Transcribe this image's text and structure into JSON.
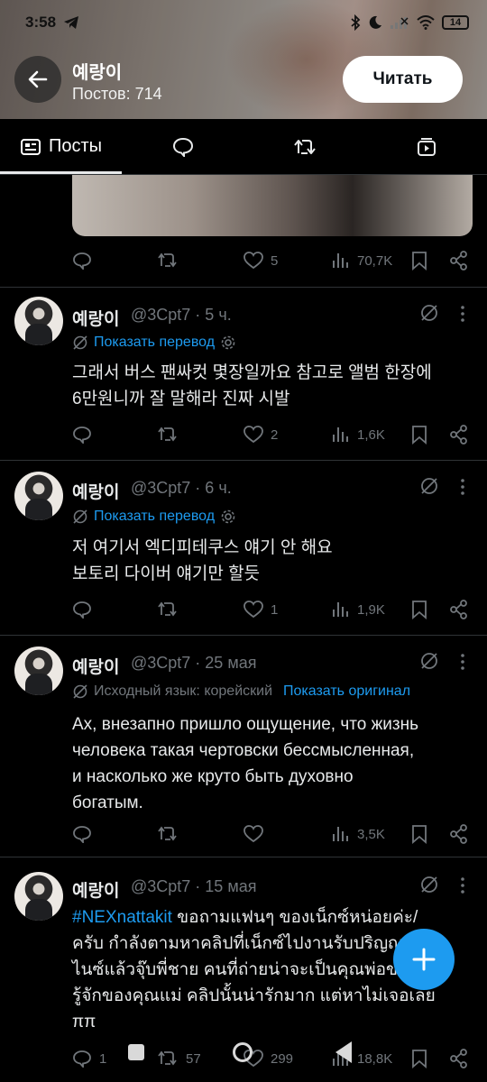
{
  "status_bar": {
    "time": "3:58",
    "battery": "14"
  },
  "profile": {
    "name": "예랑이",
    "posts_count": "Постов: 714",
    "follow_label": "Читать"
  },
  "tabs": [
    {
      "icon": "posts-icon",
      "label": "Посты",
      "active": true
    },
    {
      "icon": "replies-icon",
      "label": ""
    },
    {
      "icon": "retweet-icon",
      "label": ""
    },
    {
      "icon": "media-icon",
      "label": ""
    }
  ],
  "top_post_actions": {
    "replies": "",
    "reposts": "",
    "likes": "5",
    "views": "70,7K"
  },
  "tweets": [
    {
      "name": "예랑이",
      "handle_time": "@3Cpt7 · 5 ч.",
      "translation_link": "Показать перевод",
      "text_lines": [
        "그래서 버스 팬싸컷 몇장일까요 참고로 앨범 한장에",
        "6만원니까 잘 말해라 진짜 시발"
      ],
      "actions": {
        "replies": "",
        "reposts": "",
        "likes": "2",
        "views": "1,6K"
      }
    },
    {
      "name": "예랑이",
      "handle_time": "@3Cpt7 · 6 ч.",
      "translation_link": "Показать перевод",
      "text_lines": [
        "저 여기서 엑디피테쿠스 얘기 안 해요",
        "보토리 다이버 얘기만 할듯"
      ],
      "actions": {
        "replies": "",
        "reposts": "",
        "likes": "1",
        "views": "1,9K"
      }
    },
    {
      "name": "예랑이",
      "handle_time": "@3Cpt7 · 25 мая",
      "source_language": "Исходный язык: корейский",
      "show_original": "Показать оригинал",
      "text_lines": [
        "Ах, внезапно пришло ощущение, что жизнь",
        "человека такая чертовски бессмысленная,",
        "и насколько же круто быть духовно",
        "богатым."
      ],
      "actions": {
        "replies": "",
        "reposts": "",
        "likes": "",
        "views": "3,5K"
      }
    },
    {
      "name": "예랑이",
      "handle_time": "@3Cpt7 · 15 мая",
      "hashtag": "#NEXnattakit",
      "text_lines": [
        " ขอถามแฟนๆ ของเน็กซ์หน่อยค่ะ/",
        "ครับ กำลังตามหาคลิปที่เน็กซ์ไปงานรับปริญญาของ",
        "ไนซ์แล้วจุ๊บพี่ชาย คนที่ถ่ายน่าจะเป็นคุณพ่อของคุณ",
        "รู้จักของคุณแม่ คลิปนั้นน่ารักมาก แต่หาไม่เจอเลย",
        "ππ"
      ],
      "actions": {
        "replies": "1",
        "reposts": "57",
        "likes": "299",
        "views": "18,8K"
      }
    }
  ]
}
